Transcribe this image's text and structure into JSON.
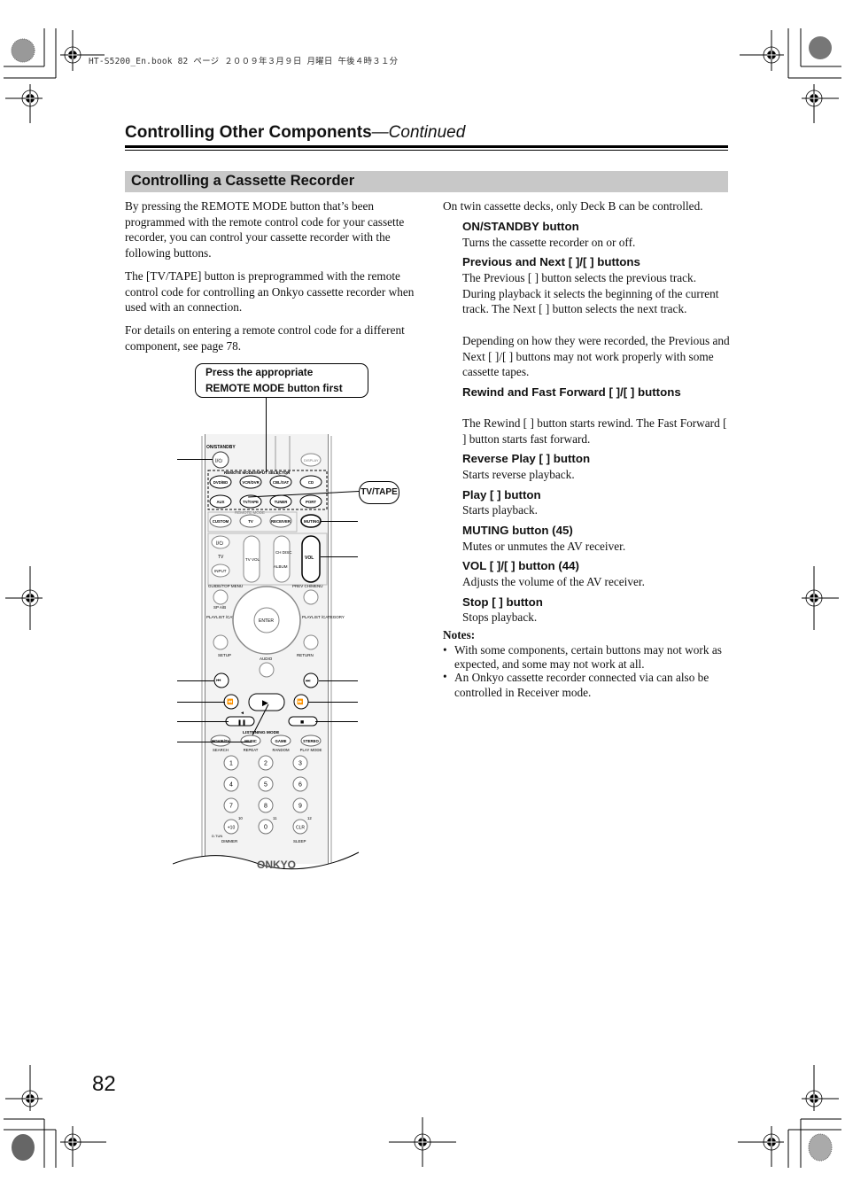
{
  "print_header": "HT-S5200_En.book  82 ページ  ２００９年３月９日  月曜日  午後４時３１分",
  "page": {
    "title": "Controlling Other Components",
    "title_suffix": "—Continued",
    "section_title": "Controlling a Cassette Recorder",
    "page_number": "82"
  },
  "left_column": {
    "paragraphs": [
      "By pressing the REMOTE MODE button that’s been programmed with the remote control code for your cassette recorder, you can control your cassette recorder with the following buttons.",
      "The [TV/TAPE] button is preprogrammed with the remote control code for controlling an Onkyo cassette recorder when used with an        connection.",
      "For details on entering a remote control code for a different component, see page 78."
    ]
  },
  "figure": {
    "callout": [
      "Press the appropriate",
      "REMOTE MODE button first"
    ],
    "tv_tape_label": "TV/TAPE",
    "remote": {
      "on_standby": "ON/STANDBY",
      "display": "DISPLAY",
      "selector_group": "REMOTE MODE/INPUT SELECTOR",
      "selector_buttons": [
        "DVD/BD",
        "VCR/DVR",
        "CBL/SAT",
        "CD",
        "AUX",
        "TV/TAPE",
        "TUNER",
        "PORT"
      ],
      "remote_mode_group": "REMOTE MODE",
      "remote_mode_buttons": [
        "CUSTOM",
        "TV",
        "RECEIVER"
      ],
      "muting": "MUTING",
      "tv_label": "TV",
      "input": "INPUT",
      "tv_vol": "TV VOL",
      "ch_disc": "CH DISC",
      "album": "ALBUM",
      "vol": "VOL",
      "guide": "GUIDE/TOP MENU",
      "prev_ch": "PREV CH/MENU",
      "sp_ab": "SP A/B",
      "playlist_l": "PLAYLIST /CATEGORY",
      "playlist_r": "PLAYLIST /CATEGORY",
      "enter": "ENTER",
      "setup": "SETUP",
      "return": "RETURN",
      "audio": "AUDIO",
      "listening_mode": "LISTENING MODE",
      "lm_buttons": [
        "MOVIE/TV",
        "MUSIC",
        "GAME",
        "STEREO"
      ],
      "lm_sub": [
        "SEARCH",
        "REPEAT",
        "RANDOM",
        "PLAY MODE"
      ],
      "numpad": [
        "1",
        "2",
        "3",
        "4",
        "5",
        "6",
        "7",
        "8",
        "9",
        "+10",
        "0",
        "CLR"
      ],
      "num_sup": [
        "10",
        "11",
        "12"
      ],
      "dtun": "D.TUN",
      "dimmer": "DIMMER",
      "sleep": "SLEEP",
      "brand": "ONKYO"
    }
  },
  "right_column": {
    "intro": "On twin cassette decks, only Deck B can be controlled.",
    "items": [
      {
        "heading": "ON/STANDBY button",
        "body": "Turns the cassette recorder on or off."
      },
      {
        "heading": "Previous and Next [       ]/[       ] buttons",
        "body": "The Previous [       ] button selects the previous track. During playback it selects the beginning of the current track. The Next [       ] button selects the next track.",
        "body2": "Depending on how they were recorded, the Previous and Next [       ]/[       ] buttons may not work properly with some cassette tapes."
      },
      {
        "heading": "Rewind and Fast Forward [       ]/[       ] buttons",
        "body": "The Rewind [       ] button starts rewind. The Fast Forward [       ] button starts fast forward."
      },
      {
        "heading": "Reverse Play [     ] button",
        "body": "Starts reverse playback."
      },
      {
        "heading": "Play [     ] button",
        "body": "Starts playback."
      },
      {
        "heading": "MUTING button (45)",
        "body": "Mutes or unmutes the AV receiver."
      },
      {
        "heading": "VOL [   ]/[   ] button (44)",
        "body": "Adjusts the volume of the AV receiver."
      },
      {
        "heading": "Stop [   ] button",
        "body": "Stops playback."
      }
    ],
    "notes_heading": "Notes:",
    "notes": [
      "With some components, certain buttons may not work as expected, and some may not work at all.",
      "An Onkyo cassette recorder connected via        can also be controlled in Receiver mode."
    ]
  }
}
